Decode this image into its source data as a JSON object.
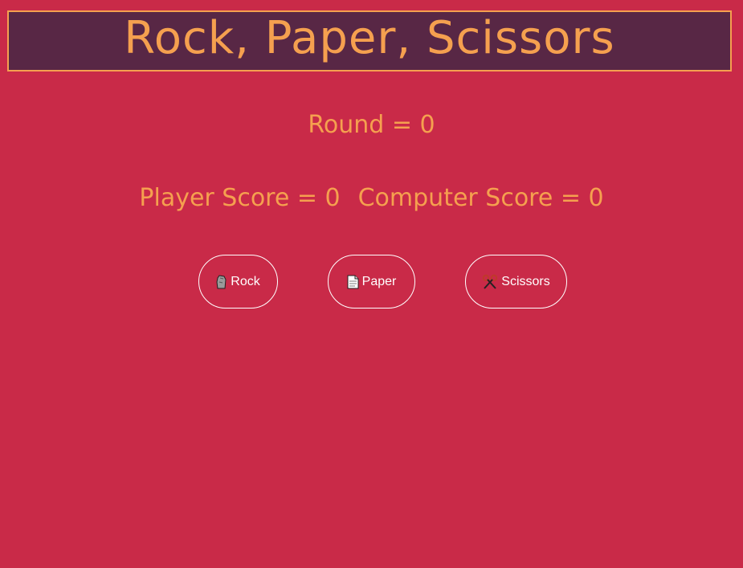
{
  "header": {
    "title": "Rock, Paper, Scissors"
  },
  "round": {
    "label": "Round = 0"
  },
  "scores": {
    "player_label": "Player Score = 0",
    "computer_label": "Computer Score = 0"
  },
  "buttons": [
    {
      "label": "Rock",
      "icon": "rock-icon"
    },
    {
      "label": "Paper",
      "icon": "paper-icon"
    },
    {
      "label": "Scissors",
      "icon": "scissors-icon"
    }
  ],
  "colors": {
    "background": "#c92a48",
    "header_background": "#582745",
    "accent": "#f5a04f",
    "button_text": "#ffffff"
  }
}
